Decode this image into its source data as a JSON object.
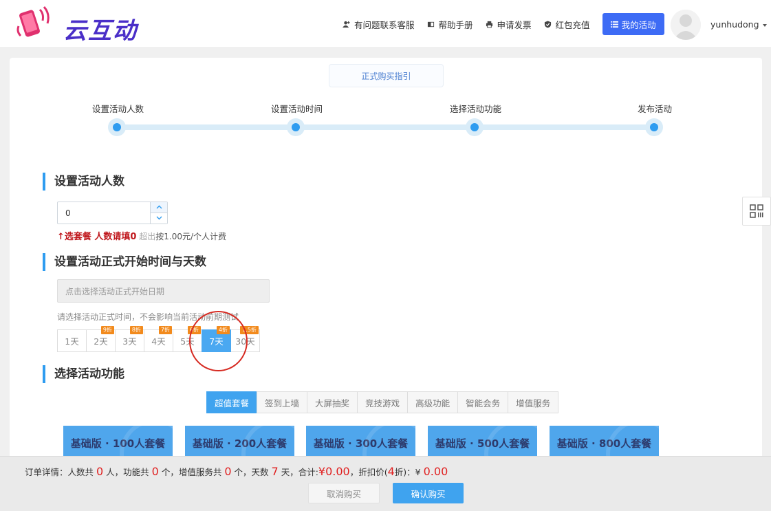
{
  "header": {
    "logo_text": "云互动",
    "nav": [
      {
        "label": "有问题联系客服",
        "icon": "user-plus-icon"
      },
      {
        "label": "帮助手册",
        "icon": "book-icon"
      },
      {
        "label": "申请发票",
        "icon": "printer-icon"
      },
      {
        "label": "红包充值",
        "icon": "shield-check-icon"
      }
    ],
    "my_activity": "我的活动",
    "username": "yunhudong"
  },
  "guide_button": "正式购买指引",
  "steps": [
    "设置活动人数",
    "设置活动时间",
    "选择活动功能",
    "发布活动"
  ],
  "section_people": {
    "title": "设置活动人数",
    "input_value": "0",
    "hint_strong": "↑选套餐 人数请填0",
    "hint_grey": " 超出",
    "hint_normal": "按1.00元/个人计费"
  },
  "section_time": {
    "title": "设置活动正式开始时间与天数",
    "date_placeholder": "点击选择活动正式开始日期",
    "date_hint": "请选择活动正式时间，不会影响当前活动前期测试",
    "days": [
      {
        "label": "1天",
        "badge": ""
      },
      {
        "label": "2天",
        "badge": "9折"
      },
      {
        "label": "3天",
        "badge": "8折"
      },
      {
        "label": "4天",
        "badge": "7折"
      },
      {
        "label": "5天",
        "badge": "6折"
      },
      {
        "label": "7天",
        "badge": "4折"
      },
      {
        "label": "30天",
        "badge": "1.5折"
      }
    ],
    "selected_day": "7天"
  },
  "section_features": {
    "title": "选择活动功能",
    "tabs": [
      "超值套餐",
      "签到上墙",
      "大屏抽奖",
      "竞技游戏",
      "高级功能",
      "智能会务",
      "增值服务"
    ],
    "active_tab": "超值套餐",
    "cards": [
      "基础版 · 100人套餐",
      "基础版 · 200人套餐",
      "基础版 · 300人套餐",
      "基础版 · 500人套餐",
      "基础版 · 800人套餐"
    ]
  },
  "footer": {
    "order_label": "订单详情：人数共",
    "people": "0",
    "people_unit": "人，功能共",
    "features": "0",
    "features_unit": "个，增值服务共",
    "services": "0",
    "services_unit": "个，天数",
    "days": "7",
    "days_unit": "天，合计:",
    "total_symbol": "¥",
    "total": "0.00",
    "discount_label": "，折扣价(",
    "discount": "4",
    "discount_unit": "折)：¥",
    "discount_total": "0.00",
    "cancel": "取消购买",
    "confirm": "确认购买"
  },
  "colors": {
    "accent": "#3fa3ef",
    "brand": "#4a2fc8",
    "nav_button": "#3d6bf5",
    "price_red": "#e01f1f",
    "badge_orange": "#f28a1c",
    "highlight_circle": "#d62a21"
  }
}
